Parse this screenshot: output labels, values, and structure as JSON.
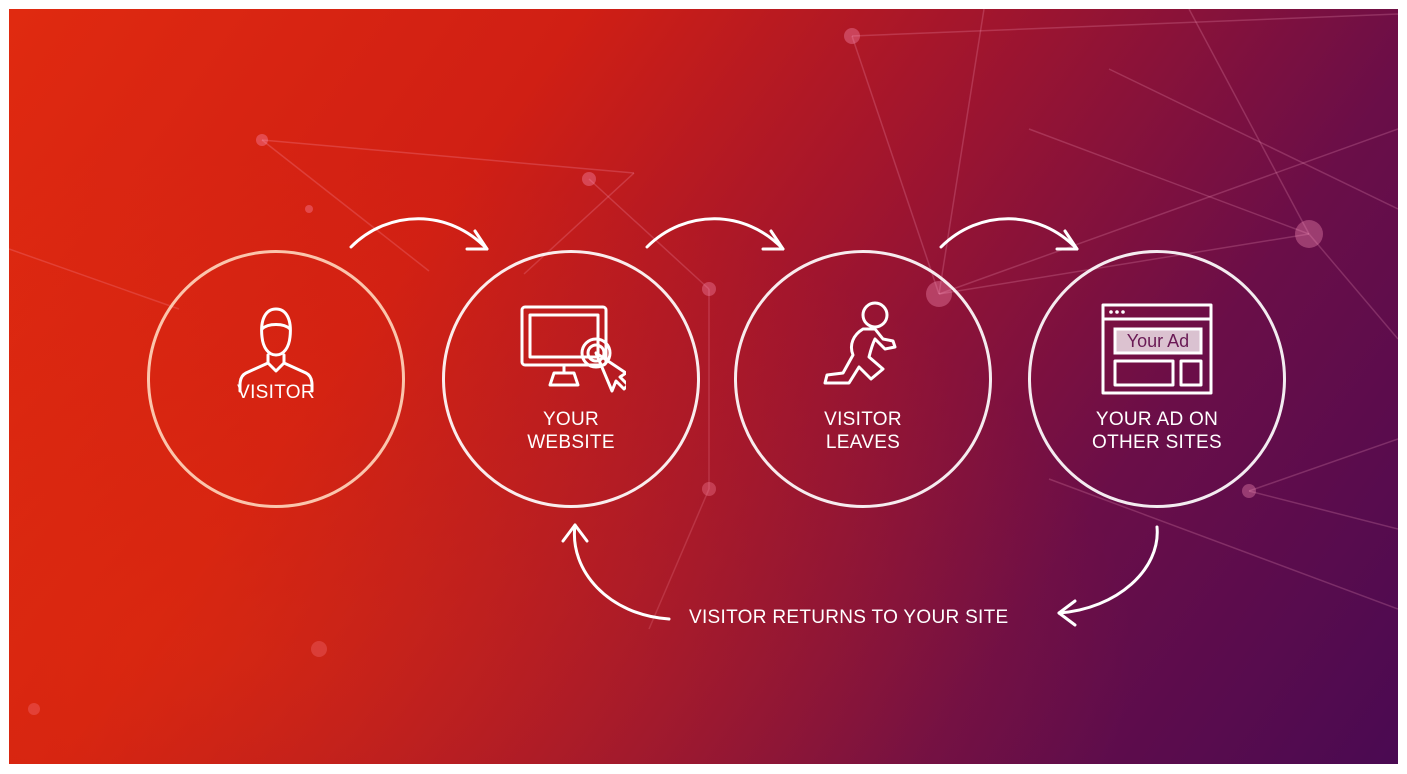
{
  "steps": [
    {
      "label_line1": "VISITOR",
      "label_line2": "",
      "icon": "person-icon"
    },
    {
      "label_line1": "YOUR",
      "label_line2": "WEBSITE",
      "icon": "monitor-click-icon"
    },
    {
      "label_line1": "VISITOR",
      "label_line2": "LEAVES",
      "icon": "running-person-icon"
    },
    {
      "label_line1": "YOUR AD ON",
      "label_line2": "OTHER SITES",
      "icon": "browser-ad-icon"
    }
  ],
  "ad_text": "Your Ad",
  "return_text": "VISITOR RETURNS TO YOUR SITE",
  "colors": {
    "gradient_start": "#e02a10",
    "gradient_end": "#4a0a52",
    "stroke": "#ffffff"
  }
}
